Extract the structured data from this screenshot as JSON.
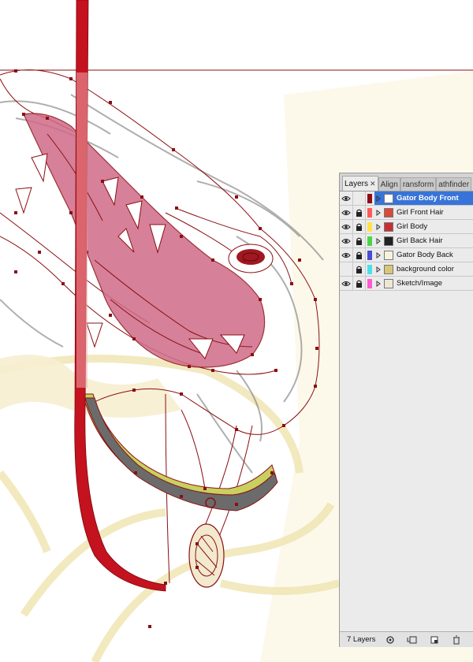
{
  "panel": {
    "tabs": [
      {
        "label": "Layers",
        "close": "✕",
        "active": true
      },
      {
        "label": "Align",
        "active": false
      },
      {
        "label": "ransform",
        "active": false
      },
      {
        "label": "athfinder",
        "active": false
      }
    ],
    "layers": [
      {
        "name": "Gator Body Front",
        "color": "#8e0d14",
        "visible": true,
        "locked": false,
        "selected": true
      },
      {
        "name": "Girl Front Hair",
        "color": "#ff5a5a",
        "visible": true,
        "locked": true,
        "selected": false
      },
      {
        "name": "Girl Body",
        "color": "#ffe14a",
        "visible": true,
        "locked": true,
        "selected": false
      },
      {
        "name": "Girl Back Hair",
        "color": "#4bd44b",
        "visible": true,
        "locked": true,
        "selected": false
      },
      {
        "name": "Gator Body Back",
        "color": "#4b4bd4",
        "visible": true,
        "locked": true,
        "selected": false
      },
      {
        "name": "background color",
        "color": "#4be0ea",
        "visible": false,
        "locked": true,
        "selected": false
      },
      {
        "name": "Sketch/Image",
        "color": "#ff5ad4",
        "visible": true,
        "locked": true,
        "selected": false
      }
    ],
    "footer": {
      "count_label": "7 Layers",
      "icons": [
        "make-clipping-mask-icon",
        "create-new-sublayer-icon",
        "create-new-layer-icon",
        "delete-layer-icon"
      ]
    }
  },
  "colors": {
    "accent_red": "#c4121f",
    "path_red": "#8b0f12",
    "mouth_pink": "#c86080",
    "collar_grey": "#6b6b6b",
    "body_cream": "#f3ecc6",
    "selection_blue": "#3874d8"
  }
}
